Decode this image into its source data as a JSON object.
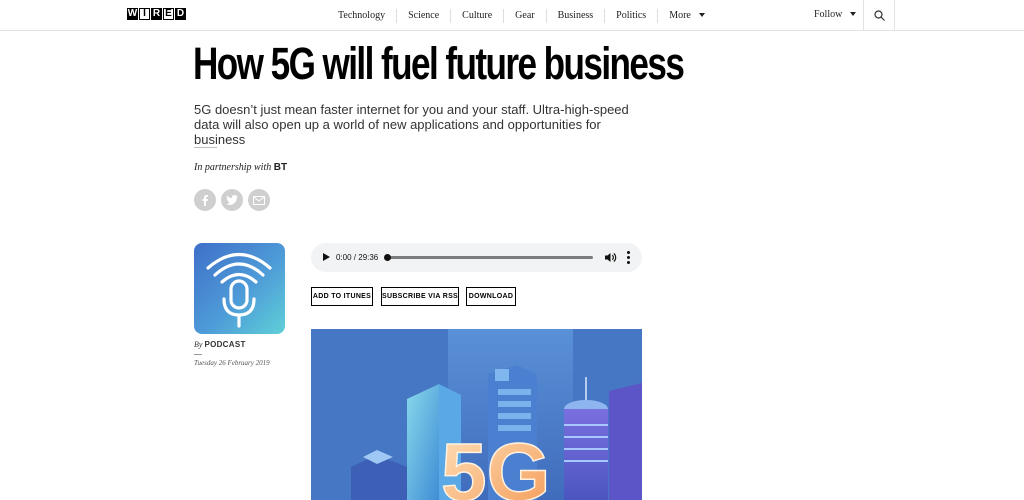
{
  "nav": {
    "logo": "WIRED",
    "links": [
      "Technology",
      "Science",
      "Culture",
      "Gear",
      "Business",
      "Politics",
      "More"
    ],
    "follow": "Follow"
  },
  "article": {
    "headline": "How 5G will fuel future business",
    "dek": "5G doesn’t just mean faster internet for you and your staff. Ultra-high-speed data will also open up a world of new applications and opportunities for business",
    "partner_prefix": "In partnership with",
    "partner_name": "BT",
    "byline_prefix": "By",
    "author": "PODCAST",
    "date": "Tuesday 26 February 2019"
  },
  "player": {
    "time": "0:00 / 29:36",
    "progress": 0
  },
  "buttons": {
    "itunes": "ADD TO ITUNES",
    "rss": "SUBSCRIBE VIA RSS",
    "download": "DOWNLOAD"
  },
  "icons": {
    "search": "search-icon",
    "share": [
      "facebook-icon",
      "twitter-icon",
      "email-icon"
    ],
    "podcast": "podcast-microphone-icon"
  },
  "colors": {
    "hero_bg": "#4677c4",
    "podcast_gradient_start": "#3f6fc9",
    "podcast_gradient_end": "#5fd0d8"
  },
  "hero": {
    "label": "5G"
  }
}
